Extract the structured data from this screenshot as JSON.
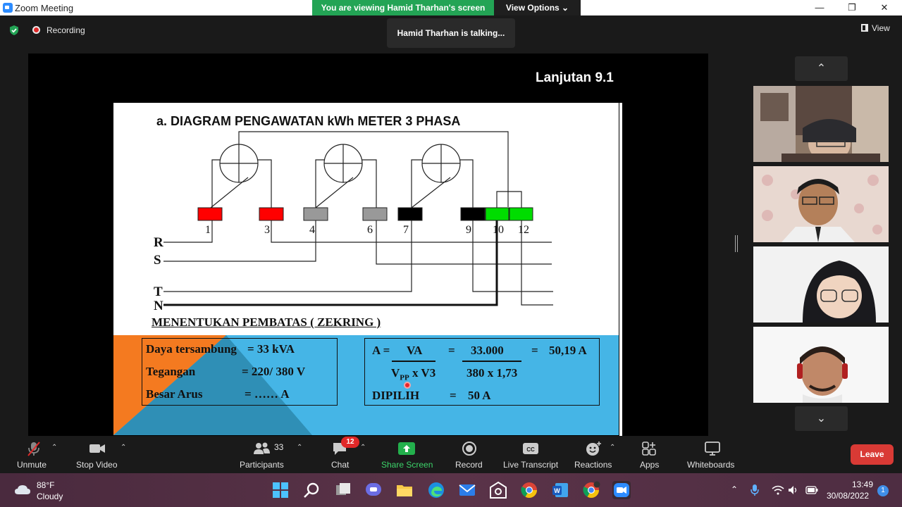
{
  "window": {
    "title": "Zoom Meeting",
    "minimize": "—",
    "maximize": "❐",
    "close": "✕"
  },
  "banner": {
    "viewing": "You are viewing Hamid Tharhan's screen",
    "view_options": "View Options ⌄"
  },
  "meeting": {
    "recording_label": "Recording",
    "talking": "Hamid Tharhan is talking...",
    "view_label": "View"
  },
  "slide": {
    "heading": "Lanjutan 9.1",
    "diagram_title": "a.   DIAGRAM PENGAWATAN kWh METER 3 PHASA",
    "terminals": [
      "1",
      "3",
      "4",
      "6",
      "7",
      "9",
      "10",
      "12"
    ],
    "phases": [
      "R",
      "S",
      "T",
      "N"
    ],
    "subtitle": "MENENTUKAN  PEMBATAS ( ZEKRING )",
    "terminal_colors": [
      "#ff0000",
      "#ff0000",
      "#999999",
      "#999999",
      "#000000",
      "#000000",
      "#00dd00",
      "#00dd00"
    ],
    "box1": {
      "row1_label": "Daya tersambung",
      "row1_value": "= 33 kVA",
      "row2_label": "Tegangan",
      "row2_value": "= 220/ 380 V",
      "row3_label": "Besar  Arus",
      "row3_value": "=  ……   A"
    },
    "box2": {
      "a_eq": "A =",
      "va": "VA",
      "eq1": "=",
      "num": "33.000",
      "eq2": "=",
      "result": "50,19 A",
      "vpp": "V",
      "vpp_sub": "PP",
      "x_v3": "x  V3",
      "denom": "380 x 1,73",
      "dipilih": "DIPILIH",
      "eq3": "=",
      "dipilih_val": "50  A"
    }
  },
  "toolbar": {
    "unmute": "Unmute",
    "stop_video": "Stop Video",
    "participants": "Participants",
    "participants_count": "33",
    "chat": "Chat",
    "chat_badge": "12",
    "share_screen": "Share Screen",
    "record": "Record",
    "live_transcript": "Live Transcript",
    "reactions": "Reactions",
    "apps": "Apps",
    "whiteboards": "Whiteboards",
    "leave": "Leave"
  },
  "taskbar": {
    "temperature": "88°F",
    "condition": "Cloudy",
    "time": "13:49",
    "date": "30/08/2022",
    "notifications": "1"
  },
  "icons": {
    "shield": "shield-check-icon",
    "mic": "mic-muted-icon",
    "video": "video-camera-icon"
  }
}
